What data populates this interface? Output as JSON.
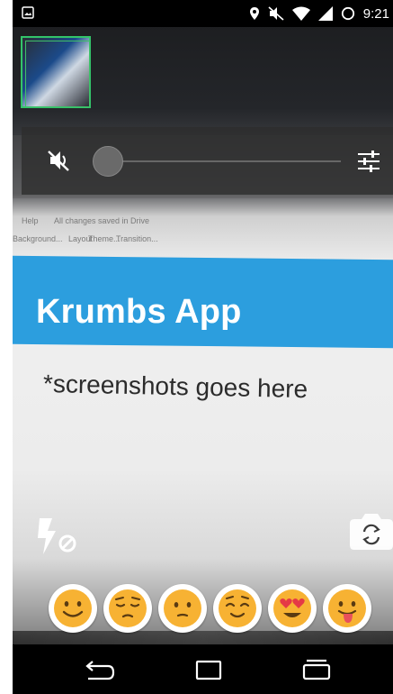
{
  "status_bar": {
    "time": "9:21",
    "icons": [
      "gallery-notification-icon",
      "location-icon",
      "mute-icon",
      "wifi-icon",
      "signal-icon",
      "battery-icon"
    ]
  },
  "viewfinder": {
    "slide_title": "Krumbs App",
    "slide_subtitle": "*screenshots goes here",
    "menu_text": "Help",
    "saved_text": "All changes saved in Drive",
    "toolbar_items": [
      "Background...",
      "Layout",
      "Theme...",
      "Transition..."
    ],
    "accent": "#2c9ede"
  },
  "thumbnail": {
    "border_color": "#33c46a"
  },
  "controls": {
    "mute_icon": "speaker-muted-icon",
    "volume_level": 0,
    "settings_icon": "tune-sliders-icon"
  },
  "camera": {
    "flash_icon": "flash-off-icon",
    "switch_icon": "switch-camera-icon"
  },
  "emojis": [
    {
      "name": "smiling-face",
      "color": "#f7b233"
    },
    {
      "name": "pensive-face",
      "color": "#f7b233"
    },
    {
      "name": "neutral-face",
      "color": "#f7b233"
    },
    {
      "name": "relieved-face",
      "color": "#f7b233"
    },
    {
      "name": "heart-eyes-face",
      "color": "#f7b233"
    },
    {
      "name": "tongue-out-face",
      "color": "#f7b233"
    }
  ],
  "nav_bar": {
    "buttons": [
      "back-icon",
      "home-icon",
      "recents-icon"
    ]
  }
}
